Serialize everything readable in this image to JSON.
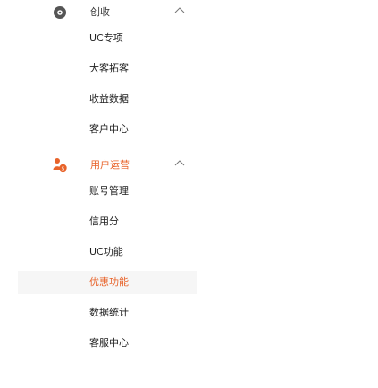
{
  "sections": [
    {
      "title": "创收",
      "icon": "settings-circle-icon",
      "collapse_icon": "chevron-up-icon",
      "items": [
        {
          "label": "UC专项",
          "active": false
        },
        {
          "label": "大客拓客",
          "active": false
        },
        {
          "label": "收益数据",
          "active": false
        },
        {
          "label": "客户中心",
          "active": false
        }
      ]
    },
    {
      "title": "用户运营",
      "icon": "user-dollar-icon",
      "collapse_icon": "chevron-up-icon",
      "items": [
        {
          "label": "账号管理",
          "active": false
        },
        {
          "label": "信用分",
          "active": false
        },
        {
          "label": "UC功能",
          "active": false
        },
        {
          "label": "优惠功能",
          "active": true
        },
        {
          "label": "数据统计",
          "active": false
        },
        {
          "label": "客服中心",
          "active": false
        }
      ]
    }
  ],
  "colors": {
    "accent": "#e8632a",
    "icon": "#555555",
    "text": "#222222",
    "active_bg": "#f5f5f5"
  }
}
